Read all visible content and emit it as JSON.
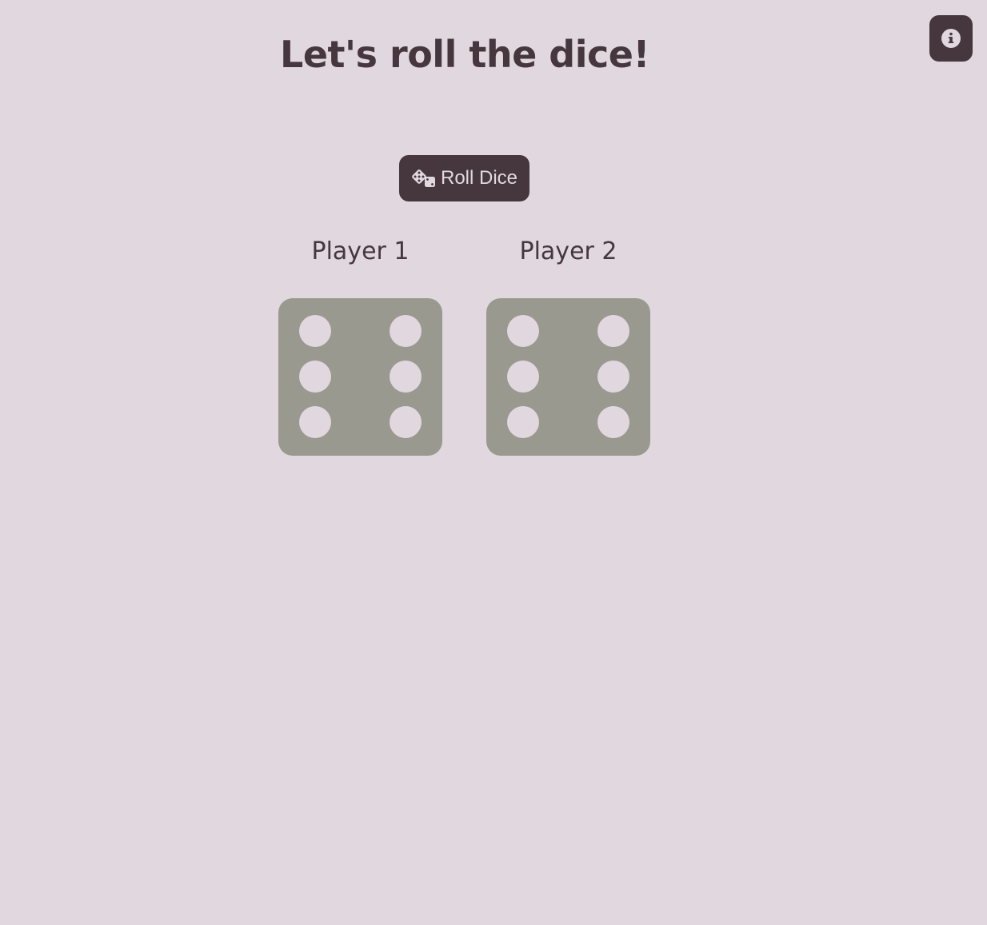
{
  "page": {
    "title": "Let's roll the dice!",
    "background_color": "#e1d7de",
    "accent_color": "#46373f",
    "die_color": "#9a998f"
  },
  "info_button": {
    "icon": "info-circle-icon"
  },
  "roll_button": {
    "icon": "dice-icon",
    "label": "Roll Dice"
  },
  "players": [
    {
      "name": "Player 1",
      "die_value": 6
    },
    {
      "name": "Player 2",
      "die_value": 6
    }
  ]
}
